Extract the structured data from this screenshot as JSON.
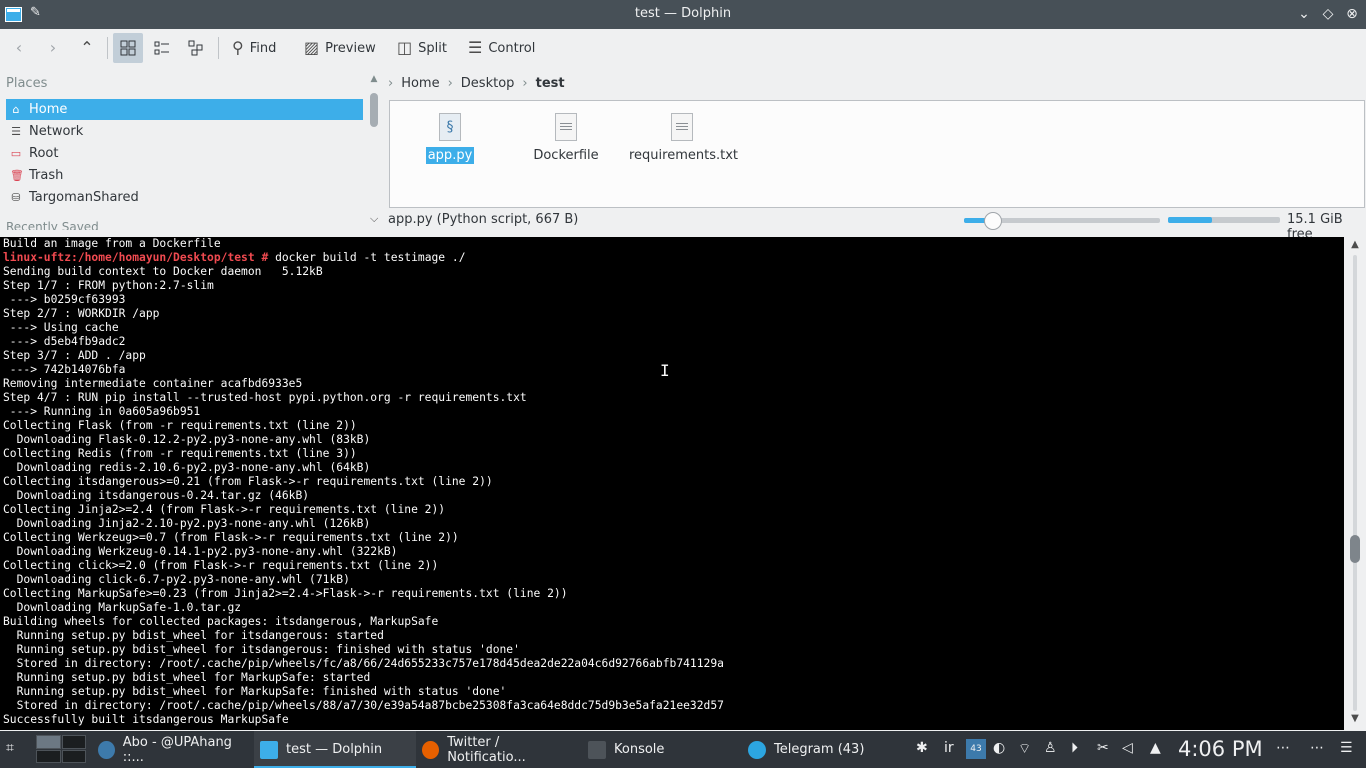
{
  "window": {
    "title": "test — Dolphin",
    "buttons": {
      "minimize": "⌄",
      "maximize": "◇",
      "close": "⊗"
    }
  },
  "toolbar": {
    "back_icon": "back-icon",
    "forward_icon": "forward-icon",
    "up_icon": "up-icon",
    "find_label": "Find",
    "preview_label": "Preview",
    "split_label": "Split",
    "control_label": "Control"
  },
  "places": {
    "title": "Places",
    "items": [
      {
        "label": "Home",
        "icon": "home-icon",
        "selected": true
      },
      {
        "label": "Network",
        "icon": "network-icon"
      },
      {
        "label": "Root",
        "icon": "root-folder-icon"
      },
      {
        "label": "Trash",
        "icon": "trash-icon"
      },
      {
        "label": "TargomanShared",
        "icon": "drive-icon"
      }
    ],
    "cut_section": "Recently Saved"
  },
  "breadcrumb": {
    "items": [
      "Home",
      "Desktop"
    ],
    "current": "test"
  },
  "files": [
    {
      "name": "app.py",
      "type": "python",
      "selected": true
    },
    {
      "name": "Dockerfile",
      "type": "text"
    },
    {
      "name": "requirements.txt",
      "type": "text"
    }
  ],
  "status": {
    "text": "app.py (Python script, 667 B)",
    "zoom_fraction": 0.15,
    "space_used_fraction": 0.39,
    "free_space": "15.1 GiB free"
  },
  "terminal": {
    "lines": [
      {
        "text": "Build an image from a Dockerfile"
      },
      {
        "prompt": "linux-uftz:/home/homayun/Desktop/test #",
        "text": " docker build -t testimage ./"
      },
      {
        "text": "Sending build context to Docker daemon   5.12kB"
      },
      {
        "text": "Step 1/7 : FROM python:2.7-slim"
      },
      {
        "text": " ---> b0259cf63993"
      },
      {
        "text": "Step 2/7 : WORKDIR /app"
      },
      {
        "text": " ---> Using cache"
      },
      {
        "text": " ---> d5eb4fb9adc2"
      },
      {
        "text": "Step 3/7 : ADD . /app"
      },
      {
        "text": " ---> 742b14076bfa"
      },
      {
        "text": "Removing intermediate container acafbd6933e5"
      },
      {
        "text": "Step 4/7 : RUN pip install --trusted-host pypi.python.org -r requirements.txt"
      },
      {
        "text": " ---> Running in 0a605a96b951"
      },
      {
        "text": "Collecting Flask (from -r requirements.txt (line 2))"
      },
      {
        "text": "  Downloading Flask-0.12.2-py2.py3-none-any.whl (83kB)"
      },
      {
        "text": "Collecting Redis (from -r requirements.txt (line 3))"
      },
      {
        "text": "  Downloading redis-2.10.6-py2.py3-none-any.whl (64kB)"
      },
      {
        "text": "Collecting itsdangerous>=0.21 (from Flask->-r requirements.txt (line 2))"
      },
      {
        "text": "  Downloading itsdangerous-0.24.tar.gz (46kB)"
      },
      {
        "text": "Collecting Jinja2>=2.4 (from Flask->-r requirements.txt (line 2))"
      },
      {
        "text": "  Downloading Jinja2-2.10-py2.py3-none-any.whl (126kB)"
      },
      {
        "text": "Collecting Werkzeug>=0.7 (from Flask->-r requirements.txt (line 2))"
      },
      {
        "text": "  Downloading Werkzeug-0.14.1-py2.py3-none-any.whl (322kB)"
      },
      {
        "text": "Collecting click>=2.0 (from Flask->-r requirements.txt (line 2))"
      },
      {
        "text": "  Downloading click-6.7-py2.py3-none-any.whl (71kB)"
      },
      {
        "text": "Collecting MarkupSafe>=0.23 (from Jinja2>=2.4->Flask->-r requirements.txt (line 2))"
      },
      {
        "text": "  Downloading MarkupSafe-1.0.tar.gz"
      },
      {
        "text": "Building wheels for collected packages: itsdangerous, MarkupSafe"
      },
      {
        "text": "  Running setup.py bdist_wheel for itsdangerous: started"
      },
      {
        "text": "  Running setup.py bdist_wheel for itsdangerous: finished with status 'done'"
      },
      {
        "text": "  Stored in directory: /root/.cache/pip/wheels/fc/a8/66/24d655233c757e178d45dea2de22a04c6d92766abfb741129a"
      },
      {
        "text": "  Running setup.py bdist_wheel for MarkupSafe: started"
      },
      {
        "text": "  Running setup.py bdist_wheel for MarkupSafe: finished with status 'done'"
      },
      {
        "text": "  Stored in directory: /root/.cache/pip/wheels/88/a7/30/e39a54a87bcbe25308fa3ca64e8ddc75d9b3e5afa21ee32d57"
      },
      {
        "text": "Successfully built itsdangerous MarkupSafe"
      }
    ]
  },
  "taskbar": {
    "tasks": [
      {
        "label": "Abo - @UPAhang  ::...",
        "icon": "browser-icon",
        "color": "#3d7aab"
      },
      {
        "label": "test — Dolphin",
        "icon": "dolphin-icon",
        "color": "#3daee9",
        "active": true
      },
      {
        "label": "Twitter / Notificatio...",
        "icon": "firefox-icon",
        "color": "#e66000"
      },
      {
        "label": "Konsole",
        "icon": "konsole-icon",
        "color": "#4d5359"
      },
      {
        "label": "Telegram (43)",
        "icon": "telegram-icon",
        "color": "#2ca5e0"
      }
    ],
    "tray": {
      "bluetooth": "✱",
      "keyboard_layout": "ir",
      "telegram_badge": "43",
      "sound": "🔊"
    },
    "clock": "4:06 PM"
  }
}
